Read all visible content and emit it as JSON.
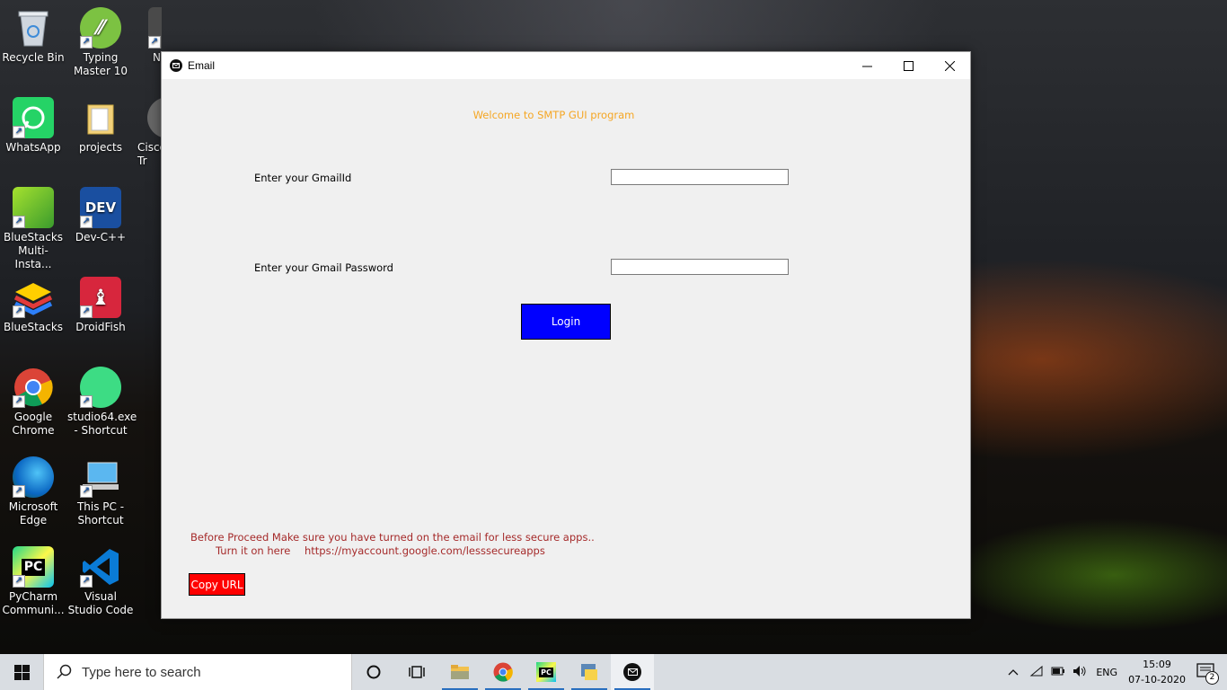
{
  "desktop": {
    "icons": [
      {
        "label": "Recycle Bin",
        "icon": "recycle-bin-icon"
      },
      {
        "label": "Typing Master 10",
        "icon": "typing-master-icon"
      },
      {
        "label": "N",
        "icon": "app-icon"
      },
      {
        "label": "WhatsApp",
        "icon": "whatsapp-icon"
      },
      {
        "label": "projects",
        "icon": "folder-icon"
      },
      {
        "label": "Cisco Tr",
        "icon": "cisco-icon"
      },
      {
        "label": "BlueStacks Multi-Insta...",
        "icon": "bluestacks-multi-icon"
      },
      {
        "label": "Dev-C++",
        "icon": "devcpp-icon"
      },
      {
        "label": "BlueStacks",
        "icon": "bluestacks-icon"
      },
      {
        "label": "DroidFish",
        "icon": "droidfish-icon"
      },
      {
        "label": "Google Chrome",
        "icon": "chrome-icon"
      },
      {
        "label": "studio64.exe - Shortcut",
        "icon": "android-studio-icon"
      },
      {
        "label": "Microsoft Edge",
        "icon": "edge-icon"
      },
      {
        "label": "This PC - Shortcut",
        "icon": "this-pc-icon"
      },
      {
        "label": "PyCharm Communi...",
        "icon": "pycharm-icon"
      },
      {
        "label": "Visual Studio Code",
        "icon": "vscode-icon"
      }
    ]
  },
  "window": {
    "title": "Email",
    "welcome": "Welcome to SMTP GUI program",
    "gmail_label": "Enter your GmailId",
    "gmail_value": "",
    "password_label": "Enter your Gmail Password",
    "password_value": "",
    "login_label": "Login",
    "warning_line1": "Before Proceed Make sure you have turned on the email for less secure apps..",
    "warning_line2_prefix": "Turn it on here",
    "warning_url": "https://myaccount.google.com/lesssecureapps",
    "copy_label": "Copy URL"
  },
  "taskbar": {
    "search_placeholder": "Type here to search",
    "language": "ENG",
    "time": "15:09",
    "date": "07-10-2020",
    "notification_count": "2"
  },
  "colors": {
    "welcome": "#f5a623",
    "login_bg": "#0000ff",
    "copy_bg": "#ff0000",
    "warning_text": "#a52a2a"
  }
}
